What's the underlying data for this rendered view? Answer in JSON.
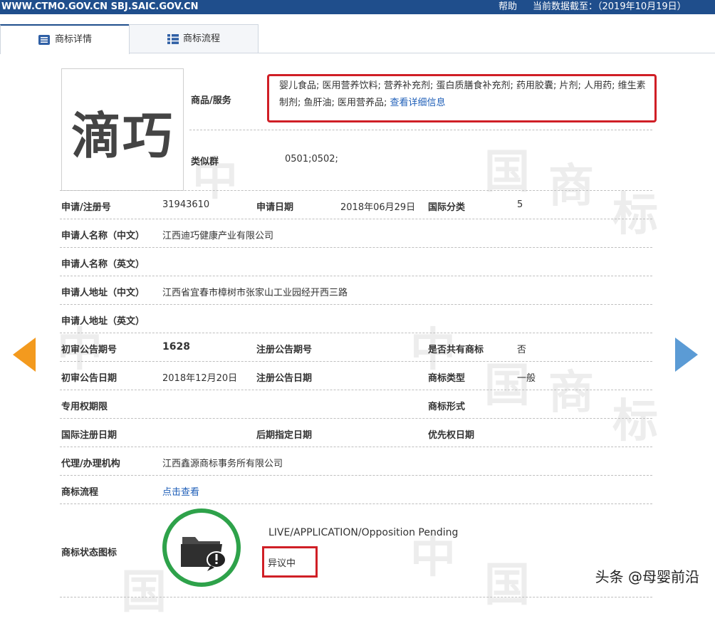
{
  "topbar": {
    "site": "WWW.CTMO.GOV.CN SBJ.SAIC.GOV.CN",
    "help": "帮助",
    "data_date": "当前数据截至：（2019年10月19日）"
  },
  "tabs": [
    {
      "label": "商标详情",
      "active": true
    },
    {
      "label": "商标流程",
      "active": false
    }
  ],
  "logo": {
    "text": "滴巧"
  },
  "goods_services": {
    "label": "商品/服务",
    "text": "婴儿食品; 医用营养饮料; 营养补充剂; 蛋白质膳食补充剂; 药用胶囊; 片剂; 人用药; 维生素制剂; 鱼肝油; 医用营养品;",
    "link": "查看详细信息"
  },
  "similar_group": {
    "label": "类似群",
    "value": "0501;0502;"
  },
  "fields": {
    "reg_no": {
      "label": "申请/注册号",
      "value": "31943610"
    },
    "app_date": {
      "label": "申请日期",
      "value": "2018年06月29日"
    },
    "intl_class": {
      "label": "国际分类",
      "value": "5"
    },
    "applicant_cn": {
      "label": "申请人名称（中文）",
      "value": "江西迪巧健康产业有限公司"
    },
    "applicant_en": {
      "label": "申请人名称（英文）",
      "value": ""
    },
    "address_cn": {
      "label": "申请人地址（中文）",
      "value": "江西省宜春市樟树市张家山工业园经开西三路"
    },
    "address_en": {
      "label": "申请人地址（英文）",
      "value": ""
    },
    "prelim_no": {
      "label": "初审公告期号",
      "value": "1628"
    },
    "reg_pub_no": {
      "label": "注册公告期号",
      "value": ""
    },
    "shared": {
      "label": "是否共有商标",
      "value": "否"
    },
    "prelim_date": {
      "label": "初审公告日期",
      "value": "2018年12月20日"
    },
    "reg_pub_date": {
      "label": "注册公告日期",
      "value": ""
    },
    "tm_type": {
      "label": "商标类型",
      "value": "一般"
    },
    "exclusive_period": {
      "label": "专用权期限",
      "value": ""
    },
    "tm_form": {
      "label": "商标形式",
      "value": ""
    },
    "intl_reg_date": {
      "label": "国际注册日期",
      "value": ""
    },
    "later_date": {
      "label": "后期指定日期",
      "value": ""
    },
    "priority_date": {
      "label": "优先权日期",
      "value": ""
    },
    "agent": {
      "label": "代理/办理机构",
      "value": "江西鑫源商标事务所有限公司"
    },
    "process": {
      "label": "商标流程",
      "value": "点击查看"
    },
    "status_icon": {
      "label": "商标状态图标"
    }
  },
  "status": {
    "en": "LIVE/APPLICATION/Opposition Pending",
    "cn": "异议中",
    "circle_color": "#2ea24a"
  },
  "colors": {
    "highlight": "#d01f26",
    "link": "#1f5fb8",
    "arrow_left": "#f39a1e",
    "arrow_right": "#5b9bd5",
    "topbar": "#1f4e8c"
  },
  "watermark": {
    "source": "头条 @母婴前沿"
  },
  "background_watermark": [
    "中",
    "国",
    "商",
    "标"
  ]
}
